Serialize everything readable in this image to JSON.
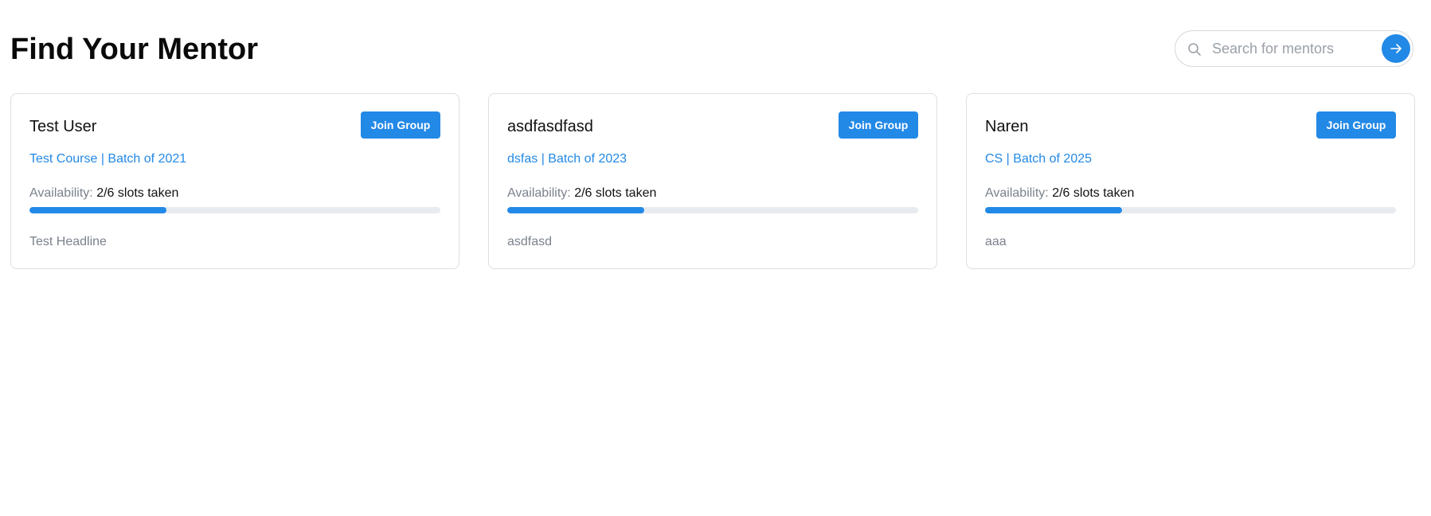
{
  "page": {
    "title": "Find Your Mentor"
  },
  "search": {
    "placeholder": "Search for mentors",
    "value": "",
    "icon": "search-icon",
    "submit_icon": "arrow-right-icon"
  },
  "colors": {
    "accent": "#2389e6",
    "track": "#e8ebef",
    "muted_text": "#7b828c",
    "card_border": "#dcdfe4"
  },
  "cards": [
    {
      "name": "Test User",
      "button_label": "Join Group",
      "subtitle": "Test Course | Batch of 2021",
      "availability_label": "Availability:",
      "availability_value": "2/6 slots taken",
      "progress_fraction": 0.3333,
      "headline": "Test Headline"
    },
    {
      "name": "asdfasdfasd",
      "button_label": "Join Group",
      "subtitle": "dsfas | Batch of 2023",
      "availability_label": "Availability:",
      "availability_value": "2/6 slots taken",
      "progress_fraction": 0.3333,
      "headline": "asdfasd"
    },
    {
      "name": "Naren",
      "button_label": "Join Group",
      "subtitle": "CS | Batch of 2025",
      "availability_label": "Availability:",
      "availability_value": "2/6 slots taken",
      "progress_fraction": 0.3333,
      "headline": "aaa"
    }
  ]
}
